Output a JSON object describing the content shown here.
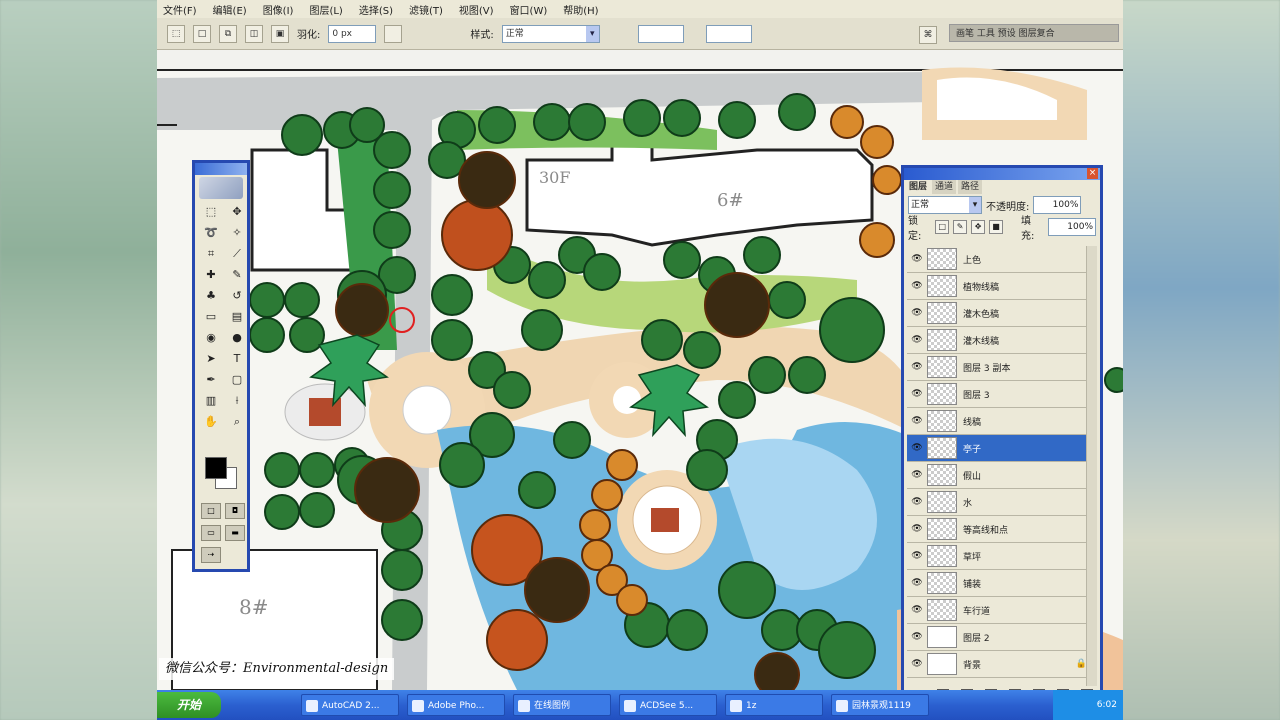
{
  "menu": [
    "文件(F)",
    "编辑(E)",
    "图像(I)",
    "图层(L)",
    "选择(S)",
    "滤镜(T)",
    "视图(V)",
    "窗口(W)",
    "帮助(H)"
  ],
  "options": {
    "feather_label": "羽化:",
    "feather_value": "0 px",
    "style_label": "样式:",
    "style_value": "正常",
    "hint": "画笔 工具 预设 图层复合"
  },
  "canvas_labels": {
    "building_30f": "30F",
    "building_6": "6#",
    "building_8": "8#",
    "watermark": "微信公众号：Environmental-design"
  },
  "colors": {
    "accent": "#2649b0",
    "selection": "#3169c6",
    "taskbar": "#2b60d0",
    "start": "#2f8f24"
  },
  "layers": {
    "tabs": [
      "图层",
      "通道",
      "路径"
    ],
    "blend_mode": "正常",
    "opacity_label": "不透明度:",
    "opacity_value": "100%",
    "lock_label": "锁定:",
    "fill_label": "填充:",
    "fill_value": "100%",
    "items": [
      {
        "name": "上色",
        "active": false
      },
      {
        "name": "植物线稿",
        "active": false
      },
      {
        "name": "灌木色稿",
        "active": false
      },
      {
        "name": "灌木线稿",
        "active": false
      },
      {
        "name": "图层 3 副本",
        "active": false
      },
      {
        "name": "图层 3",
        "active": false
      },
      {
        "name": "线稿",
        "active": false
      },
      {
        "name": "亭子",
        "active": true
      },
      {
        "name": "假山",
        "active": false
      },
      {
        "name": "水",
        "active": false
      },
      {
        "name": "等高线和点",
        "active": false
      },
      {
        "name": "草坪",
        "active": false
      },
      {
        "name": "铺装",
        "active": false
      },
      {
        "name": "车行道",
        "active": false
      },
      {
        "name": "图层 2",
        "active": false
      },
      {
        "name": "背景",
        "active": false
      }
    ]
  },
  "taskbar": {
    "start": "开始",
    "tasks": [
      "AutoCAD 2...",
      "Adobe Pho...",
      "在线图例",
      "ACDSee 5...",
      "1z",
      "园林景观1119"
    ],
    "clock": "6:02"
  }
}
